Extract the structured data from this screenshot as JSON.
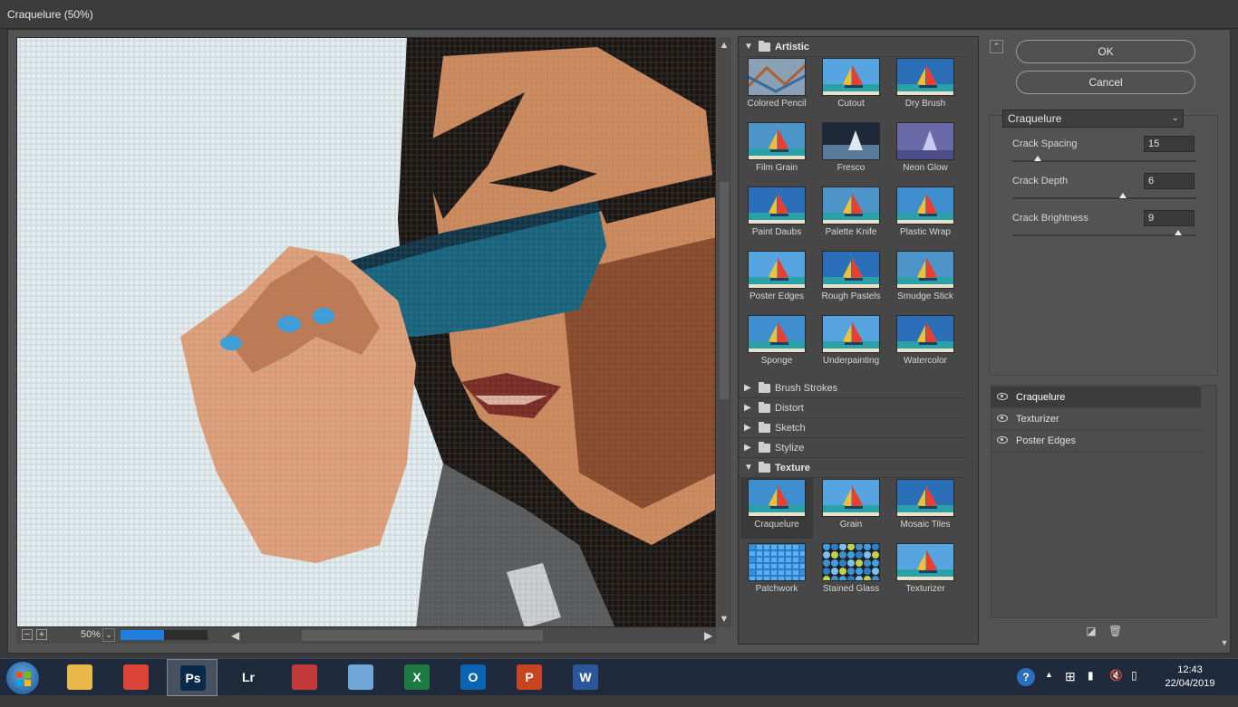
{
  "window": {
    "title": "Craquelure (50%)"
  },
  "preview": {
    "zoom": "50%",
    "progress_fraction": 0.5,
    "zoom_out_icon": "minus-icon",
    "zoom_in_icon": "plus-icon"
  },
  "gallery": {
    "categories": [
      {
        "label": "Artistic",
        "open": true
      },
      {
        "label": "Brush Strokes",
        "open": false
      },
      {
        "label": "Distort",
        "open": false
      },
      {
        "label": "Sketch",
        "open": false
      },
      {
        "label": "Stylize",
        "open": false
      },
      {
        "label": "Texture",
        "open": true
      }
    ],
    "artistic": [
      "Colored Pencil",
      "Cutout",
      "Dry Brush",
      "Film Grain",
      "Fresco",
      "Neon Glow",
      "Paint Daubs",
      "Palette Knife",
      "Plastic Wrap",
      "Poster Edges",
      "Rough Pastels",
      "Smudge Stick",
      "Sponge",
      "Underpainting",
      "Watercolor"
    ],
    "texture": [
      "Craquelure",
      "Grain",
      "Mosaic Tiles",
      "Patchwork",
      "Stained Glass",
      "Texturizer"
    ],
    "selected": "Craquelure"
  },
  "buttons": {
    "ok": "OK",
    "cancel": "Cancel"
  },
  "settings": {
    "filter": "Craquelure",
    "params": [
      {
        "label": "Crack Spacing",
        "value": "15",
        "fraction": 0.14
      },
      {
        "label": "Crack Depth",
        "value": "6",
        "fraction": 0.6
      },
      {
        "label": "Crack Brightness",
        "value": "9",
        "fraction": 0.9
      }
    ]
  },
  "layers": [
    {
      "name": "Craquelure",
      "selected": true
    },
    {
      "name": "Texturizer",
      "selected": false
    },
    {
      "name": "Poster Edges",
      "selected": false
    }
  ],
  "taskbar": {
    "apps": [
      {
        "name": "file-explorer-icon",
        "label": "",
        "color": "#e8b84a"
      },
      {
        "name": "chrome-icon",
        "label": "",
        "color": "#db4437"
      },
      {
        "name": "photoshop-icon",
        "label": "Ps",
        "color": "#0b2a4a"
      },
      {
        "name": "lightroom-icon",
        "label": "Lr",
        "color": "#1c2a3a"
      },
      {
        "name": "snipping-tool-icon",
        "label": "",
        "color": "#c23b3b"
      },
      {
        "name": "notepad-icon",
        "label": "",
        "color": "#6fa8d8"
      },
      {
        "name": "excel-icon",
        "label": "X",
        "color": "#1d7a43"
      },
      {
        "name": "outlook-icon",
        "label": "O",
        "color": "#0a64b4"
      },
      {
        "name": "powerpoint-icon",
        "label": "P",
        "color": "#c8431f"
      },
      {
        "name": "word-icon",
        "label": "W",
        "color": "#2b579a"
      }
    ],
    "time": "12:43",
    "date": "22/04/2019"
  }
}
